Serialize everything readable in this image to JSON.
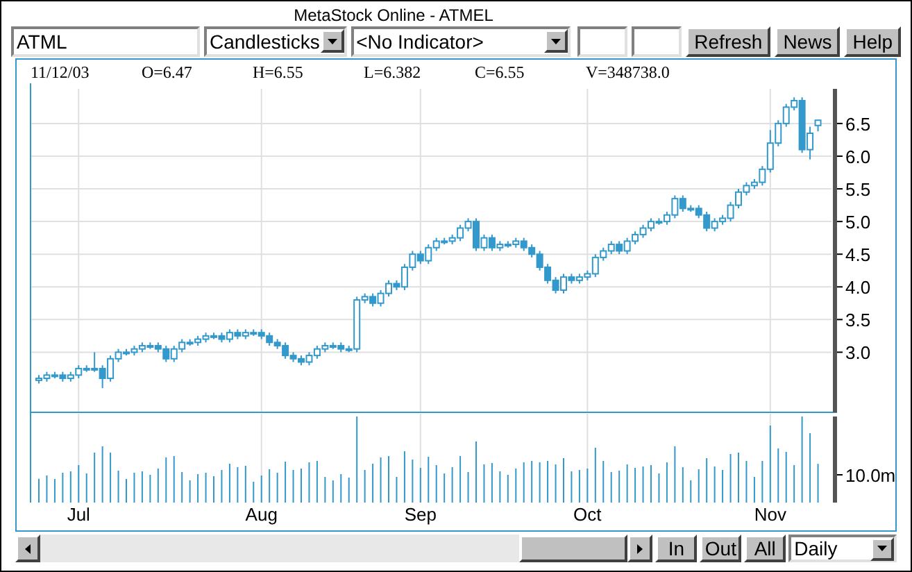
{
  "window": {
    "title": "MetaStock Online - ATMEL"
  },
  "toolbar": {
    "symbol": "ATML",
    "chart_style": "Candlesticks",
    "indicator": "<No Indicator>",
    "buttons": [
      "Refresh",
      "News",
      "Help"
    ]
  },
  "quote": [
    "11/12/03",
    "O=6.47",
    "H=6.55",
    "L=6.382",
    "C=6.55",
    "V=348738.0"
  ],
  "price_chart": {
    "chart_data": {
      "type": "candlestick",
      "grid": true,
      "ylim": [
        2.08,
        7.03
      ],
      "yticks": [
        {
          "value": 3,
          "label": "3.0"
        },
        {
          "value": 3.5,
          "label": "3.5"
        },
        {
          "value": 4,
          "label": "4.0"
        },
        {
          "value": 4.5,
          "label": "4.5"
        },
        {
          "value": 5,
          "label": "5.0"
        },
        {
          "value": 5.5,
          "label": "5.5"
        },
        {
          "value": 6,
          "label": "6.0"
        },
        {
          "value": 6.5,
          "label": "6.5"
        }
      ],
      "categories": [
        null,
        null,
        null,
        null,
        null,
        "Jul",
        null,
        null,
        null,
        null,
        null,
        null,
        null,
        null,
        null,
        null,
        null,
        null,
        null,
        null,
        null,
        null,
        null,
        null,
        null,
        null,
        null,
        null,
        "Aug",
        null,
        null,
        null,
        null,
        null,
        null,
        null,
        null,
        null,
        null,
        null,
        null,
        null,
        null,
        null,
        null,
        null,
        null,
        null,
        "Sep",
        null,
        null,
        null,
        null,
        null,
        null,
        null,
        null,
        null,
        null,
        null,
        null,
        null,
        null,
        null,
        null,
        null,
        null,
        null,
        null,
        "Oct",
        null,
        null,
        null,
        null,
        null,
        null,
        null,
        null,
        null,
        null,
        null,
        null,
        null,
        null,
        null,
        null,
        null,
        null,
        null,
        null,
        null,
        null,
        "Nov",
        null,
        null,
        null,
        null,
        null,
        null
      ],
      "color": "#3399cc",
      "ohlc": [
        [
          2.57,
          2.65,
          2.52,
          2.6
        ],
        [
          2.6,
          2.7,
          2.55,
          2.65
        ],
        [
          2.65,
          2.7,
          2.6,
          2.65
        ],
        [
          2.65,
          2.7,
          2.55,
          2.6
        ],
        [
          2.6,
          2.7,
          2.55,
          2.65
        ],
        [
          2.65,
          2.8,
          2.6,
          2.75
        ],
        [
          2.75,
          2.8,
          2.7,
          2.75
        ],
        [
          2.75,
          3.0,
          2.7,
          2.75
        ],
        [
          2.75,
          2.8,
          2.45,
          2.6
        ],
        [
          2.6,
          2.95,
          2.55,
          2.9
        ],
        [
          2.9,
          3.05,
          2.85,
          3.0
        ],
        [
          3.0,
          3.05,
          2.95,
          3.0
        ],
        [
          3.0,
          3.1,
          2.95,
          3.05
        ],
        [
          3.05,
          3.15,
          3.0,
          3.1
        ],
        [
          3.1,
          3.15,
          3.05,
          3.1
        ],
        [
          3.1,
          3.15,
          3.0,
          3.05
        ],
        [
          3.05,
          3.1,
          2.85,
          2.9
        ],
        [
          2.9,
          3.1,
          2.85,
          3.05
        ],
        [
          3.05,
          3.2,
          3.0,
          3.15
        ],
        [
          3.15,
          3.2,
          3.1,
          3.15
        ],
        [
          3.15,
          3.25,
          3.1,
          3.2
        ],
        [
          3.2,
          3.3,
          3.15,
          3.25
        ],
        [
          3.25,
          3.3,
          3.2,
          3.25
        ],
        [
          3.25,
          3.3,
          3.15,
          3.2
        ],
        [
          3.2,
          3.35,
          3.15,
          3.3
        ],
        [
          3.3,
          3.35,
          3.2,
          3.25
        ],
        [
          3.25,
          3.35,
          3.2,
          3.3
        ],
        [
          3.3,
          3.35,
          3.25,
          3.3
        ],
        [
          3.3,
          3.35,
          3.2,
          3.25
        ],
        [
          3.25,
          3.3,
          3.1,
          3.15
        ],
        [
          3.15,
          3.2,
          3.05,
          3.1
        ],
        [
          3.1,
          3.15,
          2.9,
          2.95
        ],
        [
          2.95,
          3.0,
          2.85,
          2.9
        ],
        [
          2.9,
          2.95,
          2.8,
          2.85
        ],
        [
          2.85,
          3.0,
          2.8,
          2.95
        ],
        [
          2.95,
          3.1,
          2.9,
          3.05
        ],
        [
          3.05,
          3.15,
          3.0,
          3.1
        ],
        [
          3.1,
          3.15,
          3.05,
          3.1
        ],
        [
          3.1,
          3.15,
          3.0,
          3.05
        ],
        [
          3.05,
          3.1,
          3.0,
          3.05
        ],
        [
          3.05,
          3.85,
          3.0,
          3.8
        ],
        [
          3.8,
          3.9,
          3.75,
          3.85
        ],
        [
          3.85,
          3.9,
          3.7,
          3.75
        ],
        [
          3.75,
          3.95,
          3.7,
          3.9
        ],
        [
          3.9,
          4.1,
          3.85,
          4.05
        ],
        [
          4.05,
          4.1,
          3.95,
          4.0
        ],
        [
          4.0,
          4.35,
          3.95,
          4.3
        ],
        [
          4.3,
          4.55,
          4.25,
          4.5
        ],
        [
          4.5,
          4.55,
          4.35,
          4.4
        ],
        [
          4.4,
          4.65,
          4.35,
          4.6
        ],
        [
          4.6,
          4.75,
          4.55,
          4.7
        ],
        [
          4.7,
          4.75,
          4.65,
          4.7
        ],
        [
          4.7,
          4.8,
          4.65,
          4.75
        ],
        [
          4.75,
          4.95,
          4.7,
          4.9
        ],
        [
          4.9,
          5.05,
          4.85,
          5.0
        ],
        [
          5.0,
          5.05,
          4.55,
          4.6
        ],
        [
          4.6,
          4.8,
          4.55,
          4.75
        ],
        [
          4.75,
          4.8,
          4.55,
          4.6
        ],
        [
          4.6,
          4.7,
          4.55,
          4.65
        ],
        [
          4.65,
          4.7,
          4.6,
          4.65
        ],
        [
          4.65,
          4.75,
          4.6,
          4.7
        ],
        [
          4.7,
          4.75,
          4.55,
          4.6
        ],
        [
          4.6,
          4.65,
          4.45,
          4.5
        ],
        [
          4.5,
          4.55,
          4.25,
          4.3
        ],
        [
          4.3,
          4.35,
          4.05,
          4.1
        ],
        [
          4.1,
          4.15,
          3.9,
          3.95
        ],
        [
          3.95,
          4.2,
          3.9,
          4.15
        ],
        [
          4.15,
          4.2,
          4.05,
          4.1
        ],
        [
          4.1,
          4.2,
          4.05,
          4.15
        ],
        [
          4.15,
          4.25,
          4.1,
          4.2
        ],
        [
          4.2,
          4.5,
          4.15,
          4.45
        ],
        [
          4.45,
          4.6,
          4.4,
          4.55
        ],
        [
          4.55,
          4.7,
          4.5,
          4.65
        ],
        [
          4.65,
          4.7,
          4.5,
          4.55
        ],
        [
          4.55,
          4.75,
          4.5,
          4.7
        ],
        [
          4.7,
          4.85,
          4.65,
          4.8
        ],
        [
          4.8,
          4.95,
          4.75,
          4.9
        ],
        [
          4.9,
          5.05,
          4.85,
          5.0
        ],
        [
          5.0,
          5.05,
          4.95,
          5.0
        ],
        [
          5.0,
          5.15,
          4.95,
          5.1
        ],
        [
          5.1,
          5.4,
          5.05,
          5.35
        ],
        [
          5.35,
          5.4,
          5.15,
          5.2
        ],
        [
          5.2,
          5.25,
          5.15,
          5.2
        ],
        [
          5.2,
          5.25,
          5.05,
          5.1
        ],
        [
          5.1,
          5.15,
          4.85,
          4.9
        ],
        [
          4.9,
          5.05,
          4.85,
          5.0
        ],
        [
          5.0,
          5.1,
          4.95,
          5.05
        ],
        [
          5.05,
          5.3,
          5.0,
          5.25
        ],
        [
          5.25,
          5.5,
          5.2,
          5.45
        ],
        [
          5.45,
          5.6,
          5.4,
          5.55
        ],
        [
          5.55,
          5.65,
          5.5,
          5.6
        ],
        [
          5.6,
          5.85,
          5.55,
          5.8
        ],
        [
          5.8,
          6.4,
          5.75,
          6.2
        ],
        [
          6.2,
          6.55,
          6.15,
          6.5
        ],
        [
          6.5,
          6.8,
          6.45,
          6.75
        ],
        [
          6.75,
          6.9,
          6.7,
          6.85
        ],
        [
          6.85,
          6.9,
          6.05,
          6.1
        ],
        [
          6.1,
          6.45,
          5.95,
          6.35
        ],
        [
          6.47,
          6.55,
          6.38,
          6.55
        ]
      ]
    }
  },
  "volume": {
    "scale_label": "10.0m"
  },
  "bottom_bar": {
    "buttons": [
      "In",
      "Out",
      "All"
    ],
    "period": "Daily"
  }
}
